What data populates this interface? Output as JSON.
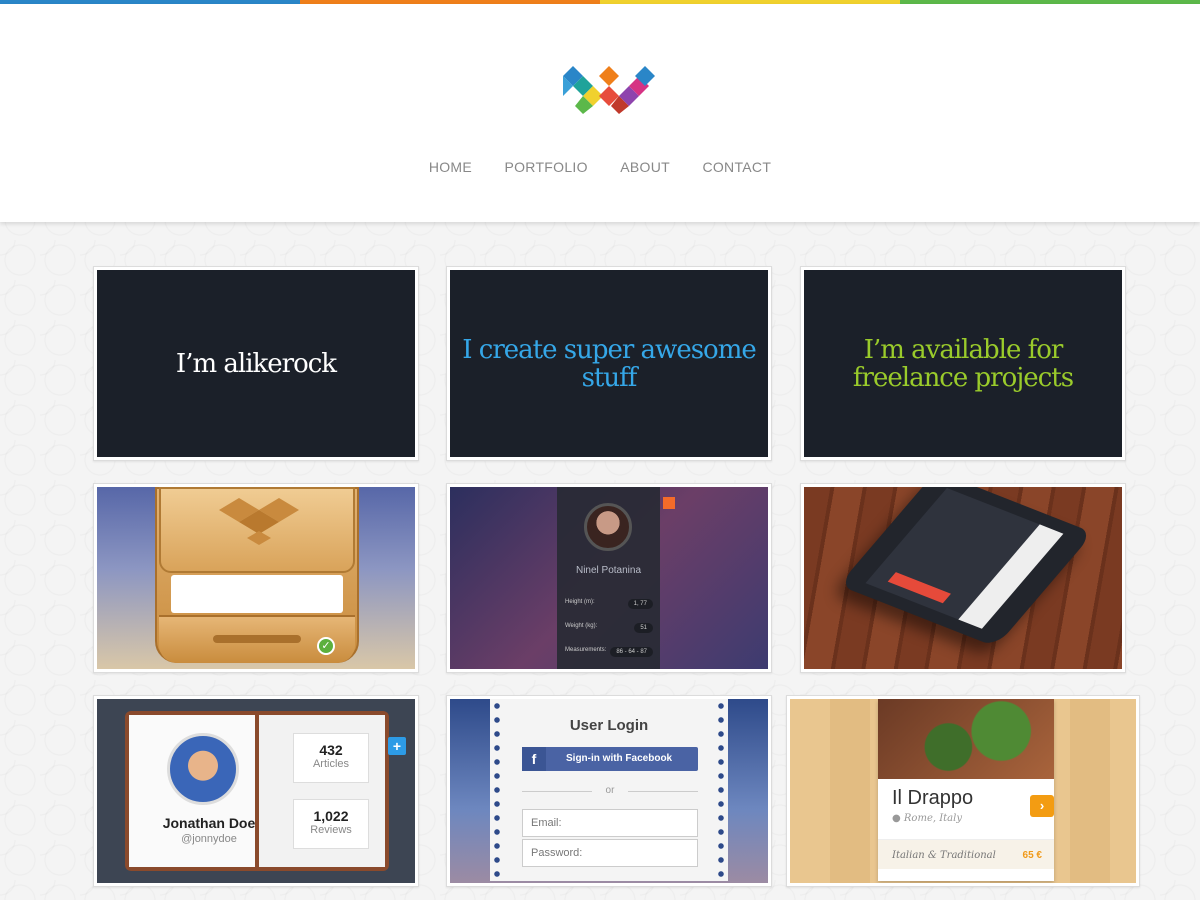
{
  "colors": {
    "topbar": [
      "#c0392b",
      "#2a86c8",
      "#ef7f1a",
      "#f0d12e",
      "#5cb84a"
    ],
    "tile1_text": "#ffffff",
    "tile2_text": "#35a7e8",
    "tile3_text": "#9acb2b",
    "tile_dark_bg": "#1b2029"
  },
  "nav": {
    "items": [
      "HOME",
      "PORTFOLIO",
      "ABOUT",
      "CONTACT"
    ]
  },
  "tiles": {
    "intro": {
      "t1": "I’m alikerock",
      "t2": "I create super awesome stuff",
      "t3": "I’m available for freelance projects"
    },
    "profile": {
      "name": "Ninel Potanina",
      "rows": [
        {
          "label": "Height (m):",
          "value": "1, 77"
        },
        {
          "label": "Weight (kg):",
          "value": "51"
        },
        {
          "label": "Measurements:",
          "value": "86 - 64 - 87"
        }
      ]
    },
    "jonathan": {
      "name": "Jonathan Doe",
      "handle": "@jonnydoe",
      "stat1_value": "432",
      "stat1_label": "Articles",
      "stat2_value": "1,022",
      "stat2_label": "Reviews",
      "plus": "+"
    },
    "login": {
      "title": "User Login",
      "fb_label": "Sign-in with Facebook",
      "fb_icon": "f",
      "or": "or",
      "email_placeholder": "Email:",
      "password_placeholder": "Password:"
    },
    "restaurant": {
      "name": "Il Drappo",
      "location": "Rome, Italy",
      "kind": "Italian & Traditional",
      "price": "65 €",
      "arrow": "›"
    },
    "dropbox": {
      "check": "✓"
    }
  }
}
